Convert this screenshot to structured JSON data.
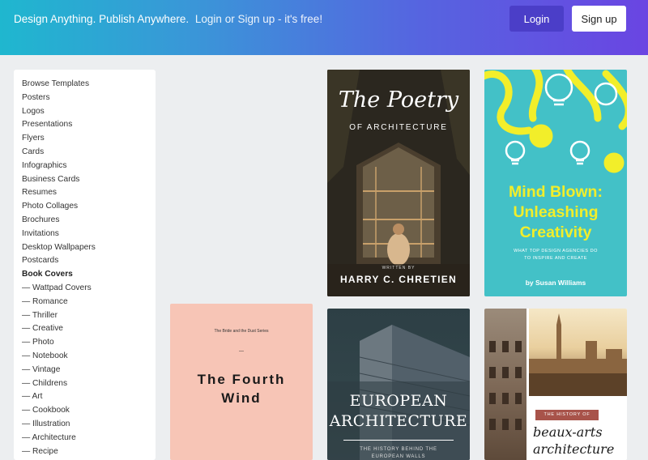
{
  "header": {
    "tagline": "Design Anything. Publish Anywhere.",
    "tagline_cta": "Login or Sign up - it's free!",
    "login_label": "Login",
    "signup_label": "Sign up"
  },
  "sidebar": {
    "items": [
      "Browse Templates",
      "Posters",
      "Logos",
      "Presentations",
      "Flyers",
      "Cards",
      "Infographics",
      "Business Cards",
      "Resumes",
      "Photo Collages",
      "Brochures",
      "Invitations",
      "Desktop Wallpapers",
      "Postcards",
      "Book Covers",
      "— Wattpad Covers",
      "— Romance",
      "— Thriller",
      "— Creative",
      "— Photo",
      "— Notebook",
      "— Vintage",
      "— Childrens",
      "— Art",
      "— Cookbook",
      "— Illustration",
      "— Architecture",
      "— Recipe"
    ],
    "active_index": 14
  },
  "cards": {
    "poetry": {
      "title": "The Poetry",
      "subtitle": "OF ARCHITECTURE",
      "written_by": "WRITTEN BY",
      "author": "HARRY C. CHRETIEN"
    },
    "mind": {
      "title_line1": "Mind Blown:",
      "title_line2": "Unleashing",
      "title_line3": "Creativity",
      "subtitle_line1": "WHAT TOP DESIGN AGENCIES DO",
      "subtitle_line2": "TO INSPIRE AND CREATE",
      "author": "by Susan Williams"
    },
    "wind": {
      "series": "The Bride and the Dust Series",
      "dash": "—",
      "title_line1": "The Fourth",
      "title_line2": "Wind"
    },
    "euro": {
      "title_line1": "EUROPEAN",
      "title_line2": "ARCHITECTURE",
      "subtitle_line1": "THE HISTORY BEHIND THE",
      "subtitle_line2": "EUROPEAN WALLS"
    },
    "beaux": {
      "label": "THE HISTORY OF",
      "title_line1": "beaux-arts",
      "title_line2": "architecture"
    }
  },
  "colors": {
    "header_start": "#1fb7cf",
    "header_end": "#6a45e2",
    "login_bg": "#4b3ec8",
    "mind_bg": "#43c1c7",
    "mind_text": "#f2ee2a",
    "wind_bg": "#f7c5b6"
  }
}
